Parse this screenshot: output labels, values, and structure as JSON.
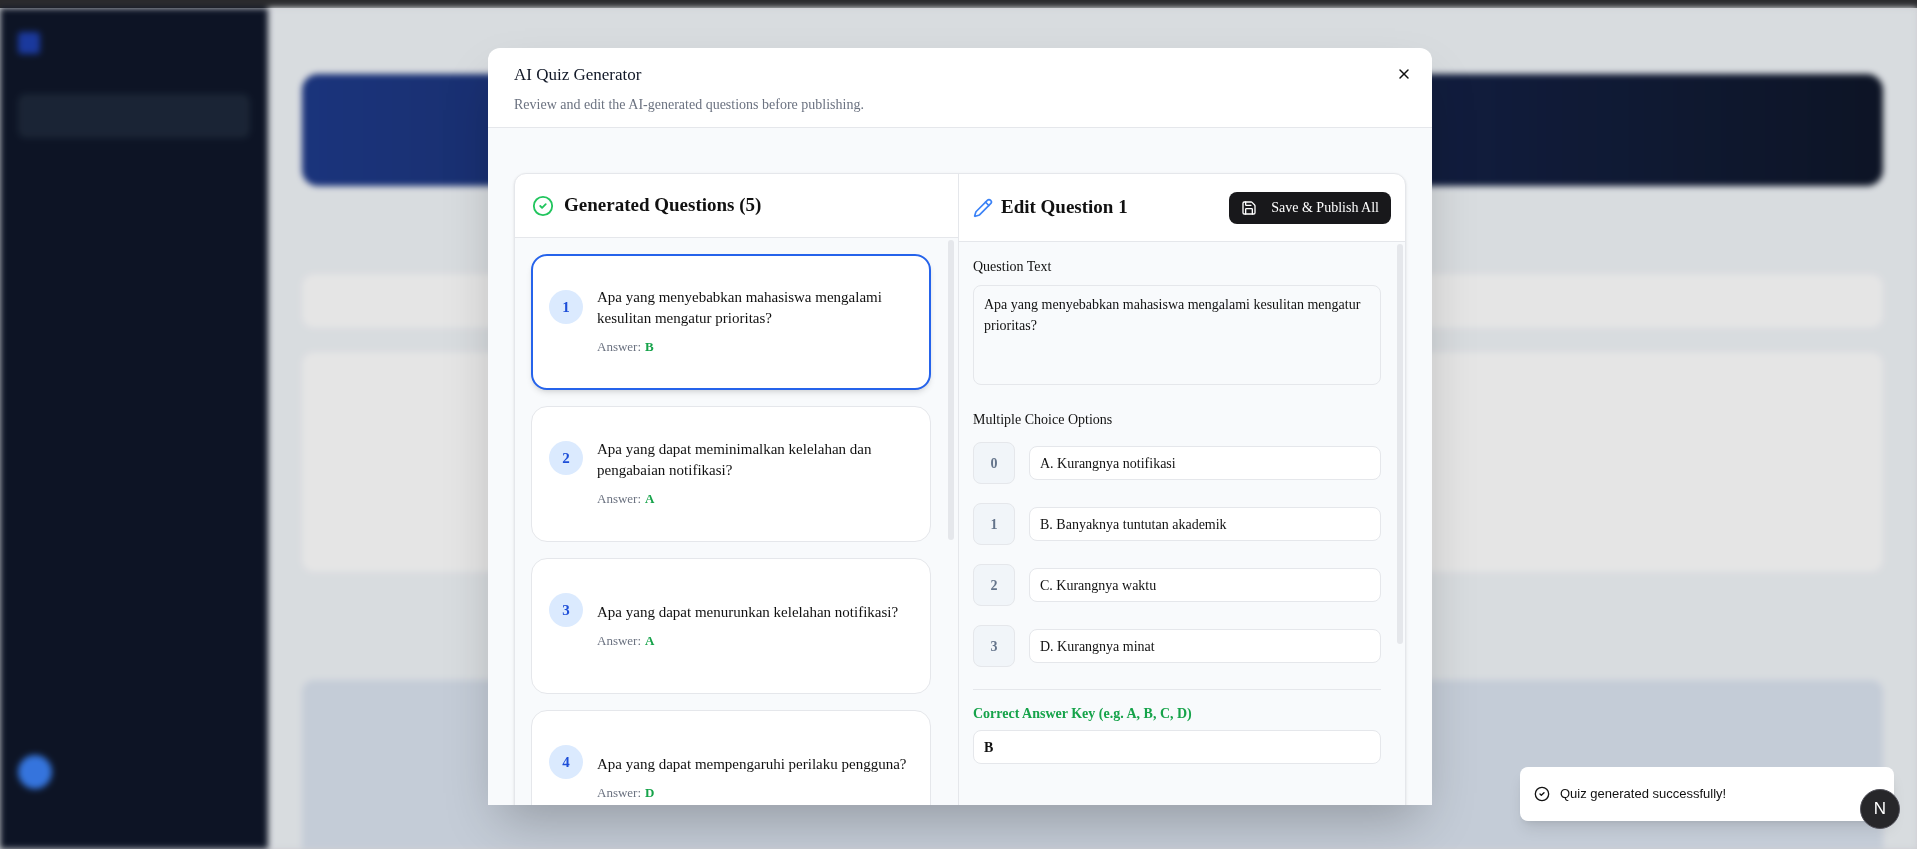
{
  "dialog": {
    "title": "AI Quiz Generator",
    "subtitle": "Review and edit the AI-generated questions before publishing."
  },
  "questions_panel": {
    "title": "Generated Questions (5)",
    "items": [
      {
        "number": "1",
        "text": "Apa yang menyebabkan mahasiswa mengalami kesulitan mengatur prioritas?",
        "answer_label": "Answer:",
        "answer": "B",
        "selected": true
      },
      {
        "number": "2",
        "text": "Apa yang dapat meminimalkan kelelahan dan pengabaian notifikasi?",
        "answer_label": "Answer:",
        "answer": "A",
        "selected": false
      },
      {
        "number": "3",
        "text": "Apa yang dapat menurunkan kelelahan notifikasi?",
        "answer_label": "Answer:",
        "answer": "A",
        "selected": false
      },
      {
        "number": "4",
        "text": "Apa yang dapat mempengaruhi perilaku pengguna?",
        "answer_label": "Answer:",
        "answer": "D",
        "selected": false
      }
    ]
  },
  "editor": {
    "title": "Edit Question 1",
    "save_button": "Save & Publish All",
    "question_label": "Question Text",
    "question_value": "Apa yang menyebabkan mahasiswa mengalami kesulitan mengatur prioritas?",
    "options_label": "Multiple Choice Options",
    "options": [
      {
        "index": "0",
        "value": "A. Kurangnya notifikasi"
      },
      {
        "index": "1",
        "value": "B. Banyaknya tuntutan akademik"
      },
      {
        "index": "2",
        "value": "C. Kurangnya waktu"
      },
      {
        "index": "3",
        "value": "D. Kurangnya minat"
      }
    ],
    "answer_key_label": "Correct Answer Key (e.g. A, B, C, D)",
    "answer_key_value": "B"
  },
  "toast": {
    "message": "Quiz generated successfully!"
  },
  "dev_badge": {
    "letter": "N"
  }
}
